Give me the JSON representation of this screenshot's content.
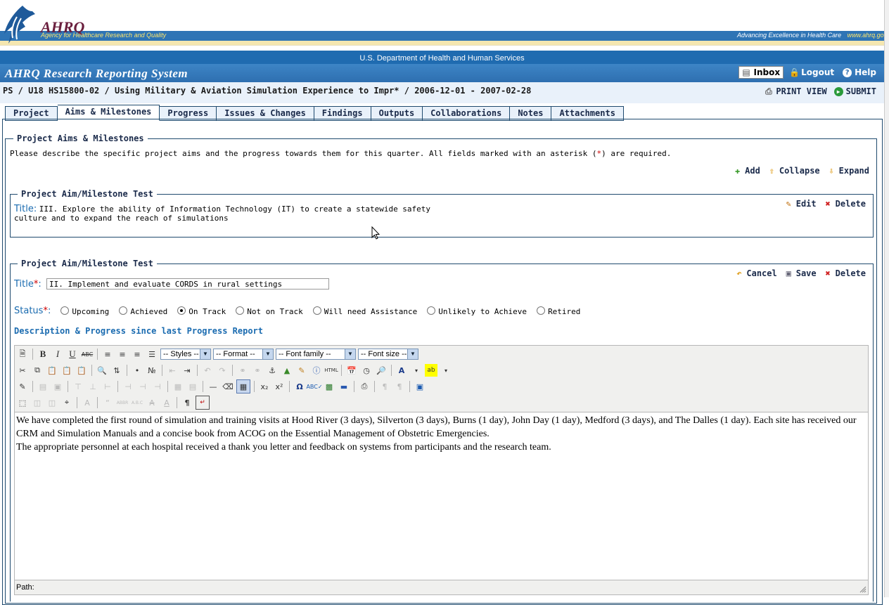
{
  "header": {
    "logo_text": "AHRQ",
    "agency_name": "Agency for Healthcare Research and Quality",
    "tagline": "Advancing Excellence in Health Care",
    "url": "www.ahrq.gov",
    "department": "U.S. Department of Health and Human Services",
    "system_title": "AHRQ Research Reporting System",
    "actions": {
      "inbox": "Inbox",
      "logout": "Logout",
      "help": "Help"
    }
  },
  "project": {
    "title": "PS / U18 HS15800-02 / Using Military & Aviation Simulation Experience to Impr* / 2006-12-01 - 2007-02-28",
    "print_view": "PRINT VIEW",
    "submit": "SUBMIT"
  },
  "tabs": [
    {
      "label": "Project",
      "active": false
    },
    {
      "label": "Aims & Milestones",
      "active": true
    },
    {
      "label": "Progress",
      "active": false
    },
    {
      "label": "Issues & Changes",
      "active": false
    },
    {
      "label": "Findings",
      "active": false
    },
    {
      "label": "Outputs",
      "active": false
    },
    {
      "label": "Collaborations",
      "active": false
    },
    {
      "label": "Notes",
      "active": false
    },
    {
      "label": "Attachments",
      "active": false
    }
  ],
  "aims_section": {
    "legend": "Project Aims & Milestones",
    "instructions_pre": "Please describe the specific project aims and the progress towards them for this quarter. All fields marked with an asterisk (",
    "instructions_star": "*",
    "instructions_post": ") are required.",
    "add": "Add",
    "collapse": "Collapse",
    "expand": "Expand"
  },
  "aim1": {
    "legend": "Project Aim/Milestone Test",
    "title_label": "Title:",
    "title_text": "III. Explore the ability of Information Technology (IT) to create a statewide safety culture and to expand the reach of simulations",
    "edit": "Edit",
    "delete": "Delete"
  },
  "aim2": {
    "legend": "Project Aim/Milestone Test",
    "cancel": "Cancel",
    "save": "Save",
    "delete": "Delete",
    "title_label": "Title",
    "required_mark": "*",
    "colon": ":",
    "title_value": "II. Implement and evaluate CORDS in rural settings",
    "status_label": "Status",
    "status_options": [
      {
        "label": "Upcoming",
        "checked": false
      },
      {
        "label": "Achieved",
        "checked": false
      },
      {
        "label": "On Track",
        "checked": true
      },
      {
        "label": "Not on Track",
        "checked": false
      },
      {
        "label": "Will need Assistance",
        "checked": false
      },
      {
        "label": "Unlikely to Achieve",
        "checked": false
      },
      {
        "label": "Retired",
        "checked": false
      }
    ],
    "description_label": "Description & Progress since last Progress Report"
  },
  "editor": {
    "styles_select": "-- Styles --",
    "format_select": "-- Format --",
    "font_family_select": "-- Font family --",
    "font_size_select": "-- Font size --",
    "content_line1": "We have completed the first round of simulation and training visits at Hood River (3 days), Silverton (3 days), Burns (1 day), John Day (1 day), Medford (3 days), and The Dalles (1 day).  Each site has received our CRM and Simulation Manuals and a concise book from ACOG on the Essential Management of Obstetric Emergencies.",
    "content_line2": "The appropriate personnel at each hospital received a thank you letter and feedback on systems from participants and the research team.",
    "path_label": "Path:"
  },
  "colors": {
    "header_blue": "#2e74b5",
    "label_blue": "#1a6bb0",
    "border_navy": "#1f4a6e",
    "required_red": "#cc0000"
  }
}
